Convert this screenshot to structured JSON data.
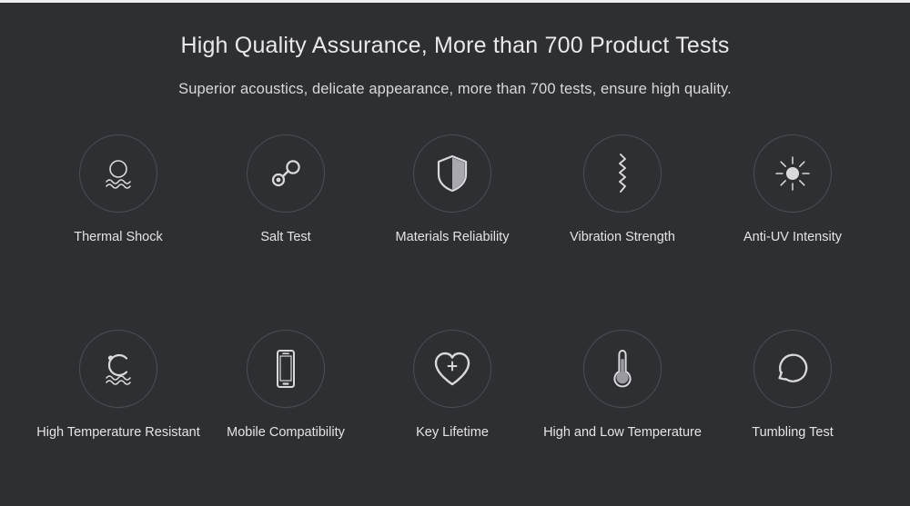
{
  "banner": {
    "headline": "High Quality Assurance, More than 700 Product Tests",
    "subhead": "Superior acoustics, delicate appearance, more than 700 tests, ensure high quality.",
    "background_color": "#2e2f33",
    "text_color": "#e9e9ec",
    "circle_border_color": "#4c4d52",
    "icon_color": "#d9d9dd",
    "rows": [
      {
        "items": [
          {
            "label": "Thermal Shock",
            "icon": "thermal-shock-icon"
          },
          {
            "label": "Salt Test",
            "icon": "salt-molecule-icon"
          },
          {
            "label": "Materials Reliability",
            "icon": "shield-icon"
          },
          {
            "label": "Vibration Strength",
            "icon": "vibration-wave-icon"
          },
          {
            "label": "Anti-UV Intensity",
            "icon": "sun-uv-icon"
          }
        ]
      },
      {
        "items": [
          {
            "label": "High Temperature Resistant",
            "icon": "celsius-wave-icon"
          },
          {
            "label": "Mobile Compatibility",
            "icon": "smartphone-icon"
          },
          {
            "label": "Key Lifetime",
            "icon": "heart-plus-icon"
          },
          {
            "label": "High and Low Temperature",
            "icon": "thermometer-icon"
          },
          {
            "label": "Tumbling Test",
            "icon": "rotation-arrow-icon"
          }
        ]
      }
    ]
  }
}
